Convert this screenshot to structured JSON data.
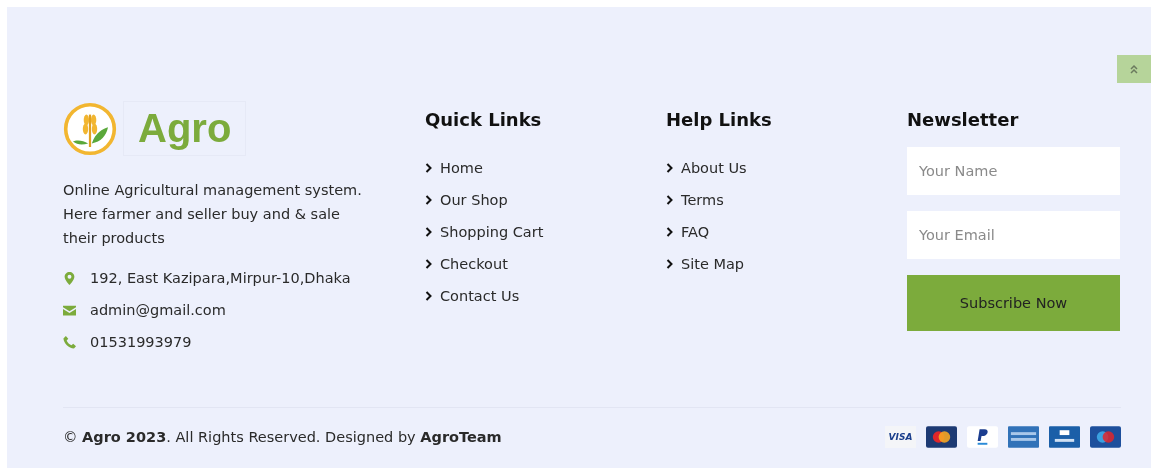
{
  "brand": {
    "name": "Agro"
  },
  "about": "Online Agricultural management system. Here farmer and seller buy and & sale their products",
  "contacts": [
    {
      "kind": "address",
      "text": "192, East Kazipara,Mirpur-10,Dhaka"
    },
    {
      "kind": "email",
      "text": "admin@gmail.com"
    },
    {
      "kind": "phone",
      "text": "01531993979"
    }
  ],
  "quick_links": {
    "title": "Quick Links",
    "items": [
      "Home",
      "Our Shop",
      "Shopping Cart",
      "Checkout",
      "Contact Us"
    ]
  },
  "help_links": {
    "title": "Help Links",
    "items": [
      "About Us",
      "Terms",
      "FAQ",
      "Site Map"
    ]
  },
  "newsletter": {
    "title": "Newsletter",
    "name_placeholder": "Your Name",
    "email_placeholder": "Your Email",
    "button": "Subscribe Now"
  },
  "copyright": "© **Agro 2023**. All Rights Reserved. Designed by **AgroTeam**",
  "payment_cards": [
    {
      "kind": "visa",
      "label": "VISA"
    },
    {
      "kind": "mastercard"
    },
    {
      "kind": "paypal"
    },
    {
      "kind": "amex"
    },
    {
      "kind": "visa-electron"
    },
    {
      "kind": "maestro"
    }
  ]
}
